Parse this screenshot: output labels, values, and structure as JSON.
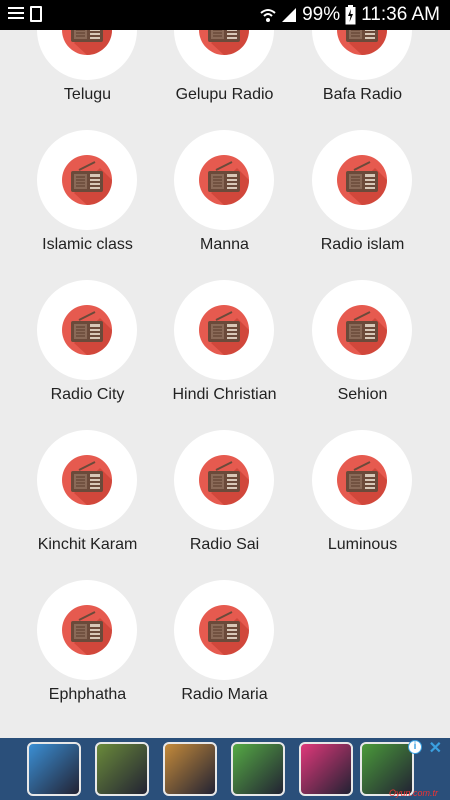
{
  "status_bar": {
    "battery": "99%",
    "time": "11:36 AM",
    "icons": [
      "list-icon",
      "document-icon",
      "wifi-icon",
      "signal-icon",
      "battery-charging-icon"
    ]
  },
  "stations": [
    {
      "label": "Telugu"
    },
    {
      "label": "Gelupu Radio"
    },
    {
      "label": "Bafa Radio"
    },
    {
      "label": "Islamic class"
    },
    {
      "label": "Manna"
    },
    {
      "label": "Radio islam"
    },
    {
      "label": "Radio City"
    },
    {
      "label": "Hindi Christian"
    },
    {
      "label": "Sehion"
    },
    {
      "label": "Kinchit Karam"
    },
    {
      "label": "Radio Sai"
    },
    {
      "label": "Luminous"
    },
    {
      "label": "Ephphatha"
    },
    {
      "label": "Radio Maria"
    }
  ],
  "ad": {
    "info_icon": "i",
    "close_icon": "✕",
    "watermark": "Oyun.com.tr",
    "thumbnail_colors": [
      "#3b8fd4",
      "#6a8a3a",
      "#c48a3a",
      "#55aa44",
      "#e0387a",
      "#4a9a3a"
    ]
  },
  "colors": {
    "radio_body": "#e65a4f",
    "radio_shadow": "#c0392b",
    "radio_panel": "#6b4a3a",
    "background": "#ececec"
  }
}
